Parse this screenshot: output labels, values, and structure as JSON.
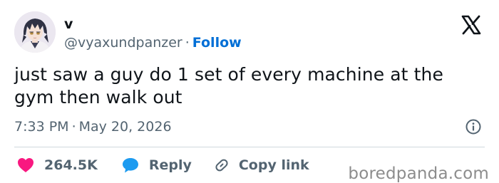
{
  "author": {
    "display_name": "v",
    "handle": "@vyaxundpanzer",
    "separator": "·",
    "follow_label": "Follow"
  },
  "tweet": {
    "text": "just saw a guy do 1 set of every machine at the gym then walk out",
    "time": "7:33 PM",
    "separator": "·",
    "date": "May 20, 2026"
  },
  "actions": {
    "likes_count": "264.5K",
    "reply_label": "Reply",
    "copy_link_label": "Copy link"
  },
  "watermark": "boredpanda.com",
  "icons": {
    "platform": "x-logo-icon",
    "info": "info-icon",
    "like": "heart-icon",
    "reply": "speech-bubble-icon",
    "copy": "link-icon"
  },
  "colors": {
    "follow": "#006fd6",
    "heart": "#f91880",
    "reply_bubble": "#1d9bf0",
    "muted_text": "#536471"
  }
}
